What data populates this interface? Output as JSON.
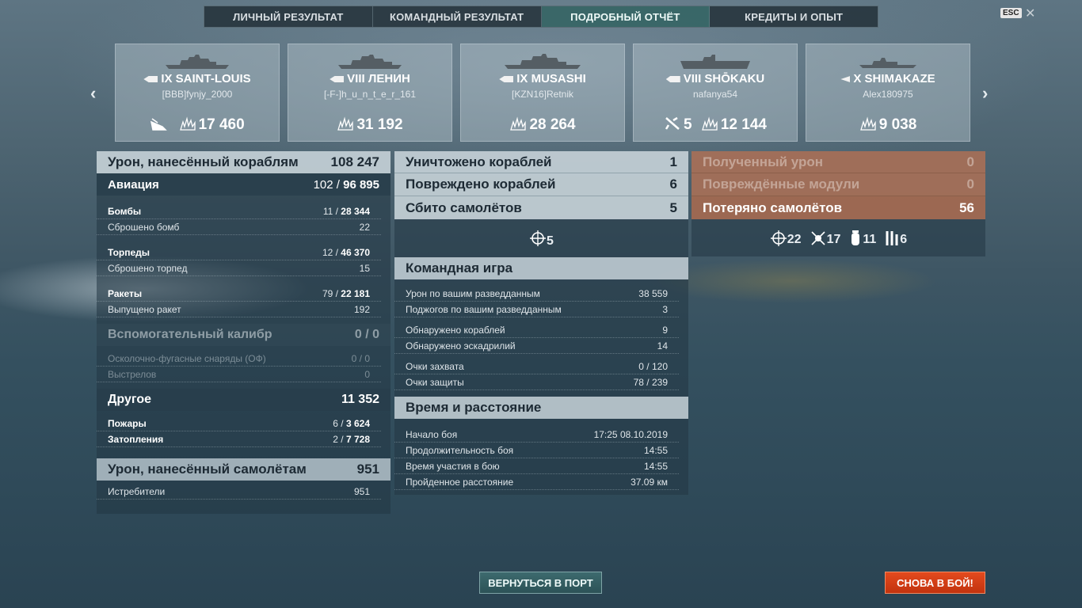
{
  "tabs": [
    "ЛИЧНЫЙ РЕЗУЛЬТАТ",
    "КОМАНДНЫЙ РЕЗУЛЬТАТ",
    "ПОДРОБНЫЙ ОТЧЁТ",
    "КРЕДИТЫ И ОПЫТ"
  ],
  "esc_label": "ESC",
  "close_glyph": "✕",
  "nav": {
    "prev": "‹",
    "next": "›"
  },
  "ships": [
    {
      "name": "IX SAINT-LOUIS",
      "player": "[BBB]fynjy_2000",
      "ship_type": "battleship",
      "stats": [
        {
          "icon": "sunk-ship-icon",
          "value": ""
        },
        {
          "icon": "damage-icon",
          "value": "17 460"
        }
      ]
    },
    {
      "name": "VIII ЛЕНИН",
      "player": "[-F-]h_u_n_t_e_r_161",
      "ship_type": "battleship",
      "stats": [
        {
          "icon": "damage-icon",
          "value": "31 192"
        }
      ]
    },
    {
      "name": "IX MUSASHI",
      "player": "[KZN16]Retnik",
      "ship_type": "battleship",
      "stats": [
        {
          "icon": "damage-icon",
          "value": "28 264"
        }
      ]
    },
    {
      "name": "VIII SHŌKAKU",
      "player": "nafanya54",
      "ship_type": "carrier",
      "stats": [
        {
          "icon": "plane-shot-icon",
          "value": "5"
        },
        {
          "icon": "damage-icon",
          "value": "12 144"
        }
      ]
    },
    {
      "name": "X SHIMAKAZE",
      "player": "Alex180975",
      "ship_type": "destroyer",
      "stats": [
        {
          "icon": "damage-icon",
          "value": "9 038"
        }
      ]
    }
  ],
  "left": {
    "ship_damage": {
      "label": "Урон, нанесённый кораблям",
      "value": "108 247"
    },
    "aviation": {
      "label": "Авиация",
      "hits": "102 / ",
      "value": "96 895"
    },
    "bombs": {
      "label": "Бомбы",
      "hits": "11 / ",
      "value": "28 344"
    },
    "bombs_dropped": {
      "label": "Сброшено бомб",
      "value": "22"
    },
    "torpedoes": {
      "label": "Торпеды",
      "hits": "12 / ",
      "value": "46 370"
    },
    "torpedoes_dropped": {
      "label": "Сброшено торпед",
      "value": "15"
    },
    "rockets": {
      "label": "Ракеты",
      "hits": "79 / ",
      "value": "22 181"
    },
    "rockets_fired": {
      "label": "Выпущено ракет",
      "value": "192"
    },
    "secondary": {
      "label": "Вспомогательный калибр",
      "value": "0 / 0"
    },
    "he_shells": {
      "label": "Осколочно-фугасные снаряды (ОФ)",
      "value": "0 / 0"
    },
    "shots": {
      "label": "Выстрелов",
      "value": "0"
    },
    "other": {
      "label": "Другое",
      "value": "11 352"
    },
    "fires": {
      "label": "Пожары",
      "hits": "6 / ",
      "value": "3 624"
    },
    "floods": {
      "label": "Затопления",
      "hits": "2 / ",
      "value": "7 728"
    },
    "plane_damage": {
      "label": "Урон, нанесённый самолётам",
      "value": "951"
    },
    "fighters": {
      "label": "Истребители",
      "value": "951"
    }
  },
  "middle": {
    "destroyed": {
      "label": "Уничтожено кораблей",
      "value": "1"
    },
    "damaged": {
      "label": "Повреждено кораблей",
      "value": "6"
    },
    "planes_shot": {
      "label": "Сбито самолётов",
      "value": "5"
    },
    "planes_shot_icon_value": "5",
    "team_play": {
      "label": "Командная игра"
    },
    "spotting_damage": {
      "label": "Урон по вашим разведданным",
      "value": "38 559"
    },
    "spotting_fires": {
      "label": "Поджогов по вашим разведданным",
      "value": "3"
    },
    "ships_spotted": {
      "label": "Обнаружено кораблей",
      "value": "9"
    },
    "squadrons_spotted": {
      "label": "Обнаружено эскадрилий",
      "value": "14"
    },
    "capture_points": {
      "label": "Очки захвата",
      "value": "0 / 120"
    },
    "defense_points": {
      "label": "Очки защиты",
      "value": "78 / 239"
    },
    "time_distance": {
      "label": "Время и расстояние"
    },
    "battle_start": {
      "label": "Начало боя",
      "value": "17:25  08.10.2019"
    },
    "battle_duration": {
      "label": "Продолжительность боя",
      "value": "14:55"
    },
    "time_in_battle": {
      "label": "Время участия в бою",
      "value": "14:55"
    },
    "distance": {
      "label": "Пройденное расстояние",
      "value": "37.09 км"
    }
  },
  "right": {
    "received_damage": {
      "label": "Полученный урон",
      "value": "0"
    },
    "damaged_modules": {
      "label": "Повреждённые модули",
      "value": "0"
    },
    "planes_lost": {
      "label": "Потеряно самолётов",
      "value": "56"
    },
    "lost_icons": [
      {
        "icon": "crosshair-icon",
        "value": "22"
      },
      {
        "icon": "fighter-down-icon",
        "value": "17"
      },
      {
        "icon": "bomb-icon",
        "value": "11"
      },
      {
        "icon": "rockets-icon",
        "value": "6"
      }
    ]
  },
  "buttons": {
    "port": "ВЕРНУТЬСЯ В ПОРТ",
    "battle": "СНОВА В БОЙ!"
  }
}
